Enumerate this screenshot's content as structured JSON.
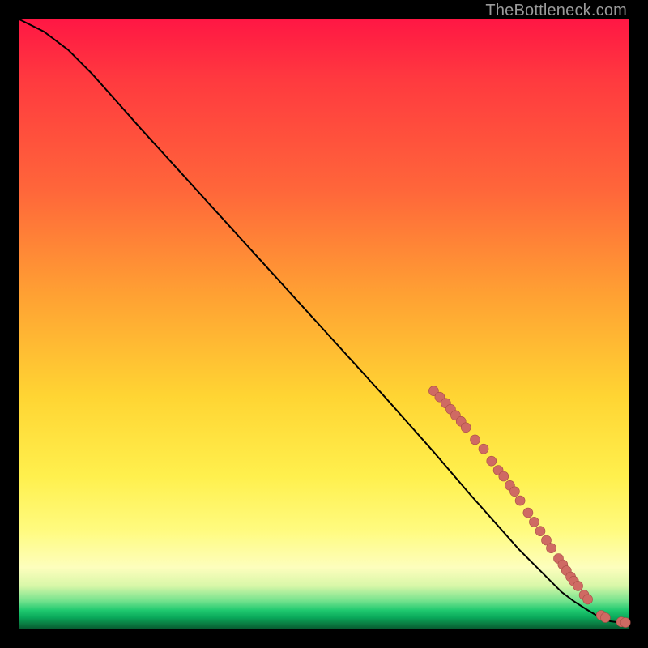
{
  "watermark": "TheBottleneck.com",
  "colors": {
    "curve": "#000000",
    "marker_fill": "#cf6a63",
    "marker_stroke": "#a74b45",
    "background": "#000000"
  },
  "chart_data": {
    "type": "line",
    "title": "",
    "xlabel": "",
    "ylabel": "",
    "xlim": [
      0,
      100
    ],
    "ylim": [
      0,
      100
    ],
    "grid": false,
    "series": [
      {
        "name": "curve",
        "x": [
          0,
          4,
          8,
          12,
          20,
          30,
          40,
          50,
          60,
          68,
          74,
          78,
          82,
          86,
          89,
          91,
          93,
          95,
          97,
          98.5,
          100
        ],
        "y": [
          100,
          98,
          95,
          91,
          82,
          71,
          60,
          49,
          38,
          29,
          22,
          17.5,
          13,
          9,
          6,
          4.5,
          3.2,
          2,
          1.2,
          1,
          1
        ]
      }
    ],
    "markers": [
      {
        "x": 68.0,
        "y": 39.0
      },
      {
        "x": 69.0,
        "y": 38.0
      },
      {
        "x": 70.0,
        "y": 37.0
      },
      {
        "x": 70.8,
        "y": 36.0
      },
      {
        "x": 71.6,
        "y": 35.0
      },
      {
        "x": 72.5,
        "y": 34.0
      },
      {
        "x": 73.3,
        "y": 33.0
      },
      {
        "x": 74.8,
        "y": 31.0
      },
      {
        "x": 76.2,
        "y": 29.5
      },
      {
        "x": 77.5,
        "y": 27.5
      },
      {
        "x": 78.6,
        "y": 26.0
      },
      {
        "x": 79.5,
        "y": 25.0
      },
      {
        "x": 80.5,
        "y": 23.5
      },
      {
        "x": 81.3,
        "y": 22.5
      },
      {
        "x": 82.2,
        "y": 21.0
      },
      {
        "x": 83.5,
        "y": 19.0
      },
      {
        "x": 84.5,
        "y": 17.5
      },
      {
        "x": 85.5,
        "y": 16.0
      },
      {
        "x": 86.5,
        "y": 14.5
      },
      {
        "x": 87.3,
        "y": 13.2
      },
      {
        "x": 88.5,
        "y": 11.5
      },
      {
        "x": 89.2,
        "y": 10.5
      },
      {
        "x": 89.8,
        "y": 9.5
      },
      {
        "x": 90.5,
        "y": 8.5
      },
      {
        "x": 91.0,
        "y": 7.8
      },
      {
        "x": 91.7,
        "y": 7.0
      },
      {
        "x": 92.7,
        "y": 5.5
      },
      {
        "x": 93.3,
        "y": 4.8
      },
      {
        "x": 95.5,
        "y": 2.2
      },
      {
        "x": 96.2,
        "y": 1.8
      },
      {
        "x": 98.8,
        "y": 1.1
      },
      {
        "x": 99.5,
        "y": 1.0
      }
    ]
  }
}
